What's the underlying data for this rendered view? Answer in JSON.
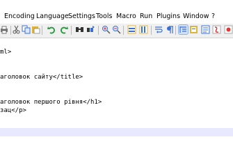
{
  "menu": [
    "Encoding",
    "Language",
    "Settings",
    "Tools",
    "Macro",
    "Run",
    "Plugins",
    "Window",
    "?"
  ],
  "toolbar": {
    "icons": [
      "print-icon",
      "cut-icon",
      "copy-icon",
      "paste-icon",
      "undo-icon",
      "redo-icon",
      "find-icon",
      "replace-icon",
      "zoom-in-icon",
      "zoom-out-icon",
      "sync-vertical-icon",
      "sync-horizontal-icon",
      "word-wrap-icon",
      "show-all-characters-icon",
      "indent-guide-icon",
      "document-map-icon",
      "function-list-icon",
      "record-macro-icon"
    ],
    "colors": {
      "blue": "#3a6fd8",
      "red": "#d83a3a",
      "green": "#2f9e44",
      "yellow": "#e0b43a",
      "gray": "#7a7a7a"
    }
  },
  "editor": {
    "lines": [
      "ml>",
      "",
      "",
      "аголовок сайту</title>",
      "",
      "",
      "аголовок першого рівня</h1>",
      "зац</p>",
      "",
      "",
      ""
    ],
    "current_line_index": 10
  }
}
